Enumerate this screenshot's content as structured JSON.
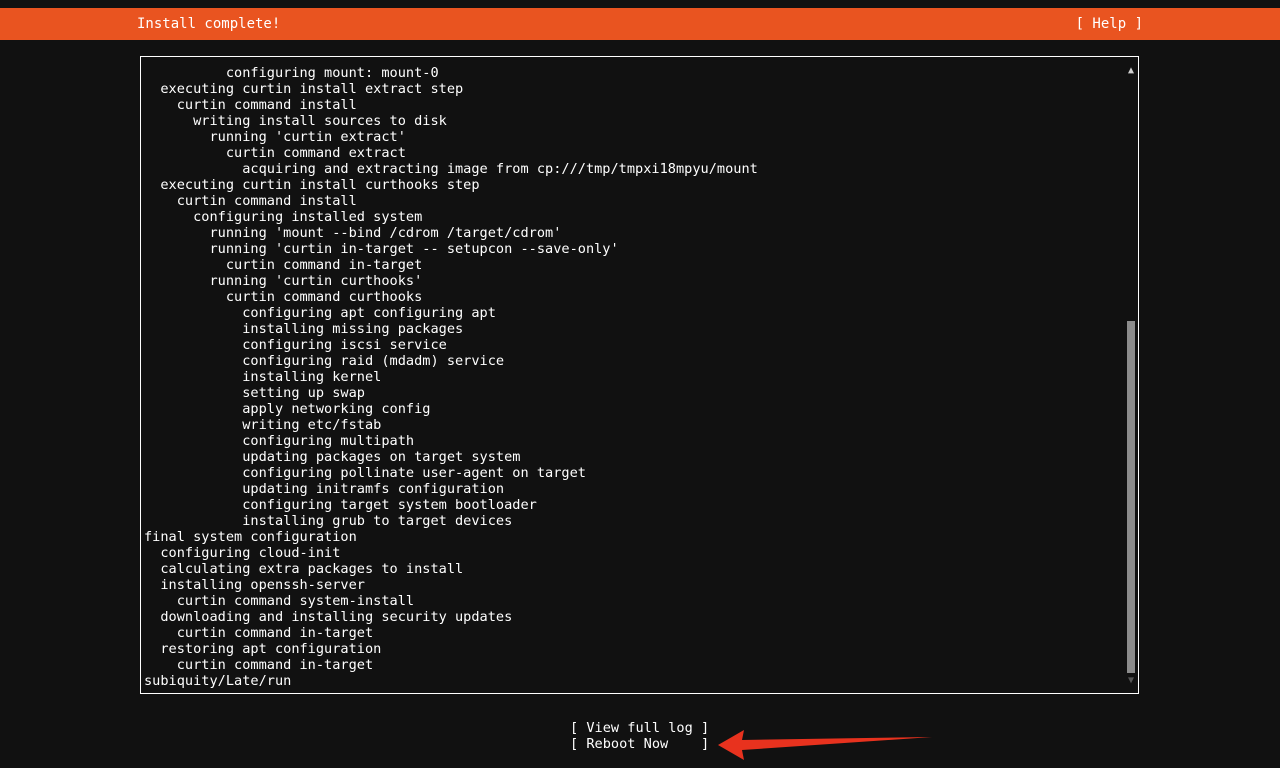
{
  "header": {
    "title": "Install complete!",
    "help_label": "[ Help ]",
    "color": "#e95420"
  },
  "log": {
    "lines": [
      "          configuring mount: mount-0",
      "  executing curtin install extract step",
      "    curtin command install",
      "      writing install sources to disk",
      "        running 'curtin extract'",
      "          curtin command extract",
      "            acquiring and extracting image from cp:///tmp/tmpxi18mpyu/mount",
      "  executing curtin install curthooks step",
      "    curtin command install",
      "      configuring installed system",
      "        running 'mount --bind /cdrom /target/cdrom'",
      "        running 'curtin in-target -- setupcon --save-only'",
      "          curtin command in-target",
      "        running 'curtin curthooks'",
      "          curtin command curthooks",
      "            configuring apt configuring apt",
      "            installing missing packages",
      "            configuring iscsi service",
      "            configuring raid (mdadm) service",
      "            installing kernel",
      "            setting up swap",
      "            apply networking config",
      "            writing etc/fstab",
      "            configuring multipath",
      "            updating packages on target system",
      "            configuring pollinate user-agent on target",
      "            updating initramfs configuration",
      "            configuring target system bootloader",
      "            installing grub to target devices",
      "final system configuration",
      "  configuring cloud-init",
      "  calculating extra packages to install",
      "  installing openssh-server",
      "    curtin command system-install",
      "  downloading and installing security updates",
      "    curtin command in-target",
      "  restoring apt configuration",
      "    curtin command in-target",
      "subiquity/Late/run"
    ],
    "scroll_up_icon": "▲",
    "scroll_down_icon": "▼"
  },
  "buttons": {
    "view_full_log": "[ View full log ]",
    "reboot_now": "[ Reboot Now    ]"
  },
  "annotation": {
    "arrow_color": "#e8321e"
  }
}
